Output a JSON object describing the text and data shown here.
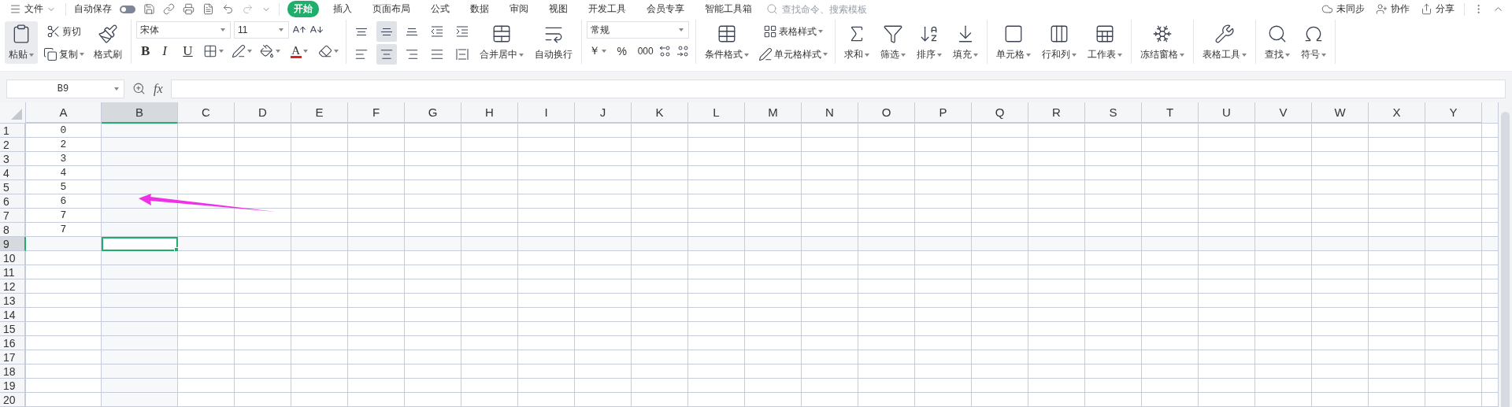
{
  "menu": {
    "file": "文件",
    "autosave": {
      "label": "自动保存",
      "on": false
    }
  },
  "tabs": [
    {
      "label": "开始",
      "selected": true
    },
    {
      "label": "插入",
      "selected": false
    },
    {
      "label": "页面布局",
      "selected": false
    },
    {
      "label": "公式",
      "selected": false
    },
    {
      "label": "数据",
      "selected": false
    },
    {
      "label": "审阅",
      "selected": false
    },
    {
      "label": "视图",
      "selected": false
    },
    {
      "label": "开发工具",
      "selected": false
    },
    {
      "label": "会员专享",
      "selected": false
    },
    {
      "label": "智能工具箱",
      "selected": false
    }
  ],
  "search": {
    "placeholder": "查找命令、搜索模板"
  },
  "account": {
    "sync": "未同步",
    "collaborate": "协作",
    "share": "分享"
  },
  "clipboard": {
    "paste": "粘贴",
    "cut": "剪切",
    "copy": "复制",
    "format_painter": "格式刷"
  },
  "font": {
    "name": "宋体",
    "size": "11",
    "bold": "B",
    "italic": "I",
    "underline": "U",
    "font_color": "A"
  },
  "alignment": {
    "buttons": [
      {
        "kind": "top",
        "selected": false
      },
      {
        "kind": "middle",
        "selected": true
      },
      {
        "kind": "bottom",
        "selected": false
      },
      {
        "kind": "indent-decrease",
        "selected": false
      },
      {
        "kind": "indent-increase",
        "selected": false
      },
      {
        "kind": "left",
        "selected": false
      },
      {
        "kind": "center",
        "selected": true
      },
      {
        "kind": "right",
        "selected": false
      },
      {
        "kind": "justify",
        "selected": false
      },
      {
        "kind": "distributed",
        "selected": false
      }
    ],
    "merge": "合并居中",
    "wrap": "自动换行"
  },
  "number": {
    "format": "常规",
    "currency": "￥",
    "percent": "%",
    "thousands": "000"
  },
  "styles": {
    "conditional": "条件格式",
    "table_style": "表格样式",
    "cell_style": "单元格样式"
  },
  "tool_groups": [
    {
      "tools": [
        {
          "kind": "sum",
          "label": "求和"
        },
        {
          "kind": "filter",
          "label": "筛选"
        },
        {
          "kind": "sort",
          "label": "排序"
        },
        {
          "kind": "fill",
          "label": "填充"
        }
      ]
    },
    {
      "tools": [
        {
          "kind": "cell",
          "label": "单元格"
        },
        {
          "kind": "rowcol",
          "label": "行和列"
        },
        {
          "kind": "sheet",
          "label": "工作表"
        }
      ]
    },
    {
      "tools": [
        {
          "kind": "freeze",
          "label": "冻结窗格"
        }
      ]
    },
    {
      "tools": [
        {
          "kind": "tabletools",
          "label": "表格工具"
        }
      ]
    },
    {
      "tools": [
        {
          "kind": "find",
          "label": "查找"
        },
        {
          "kind": "symbol",
          "label": "符号"
        }
      ]
    }
  ],
  "formula_bar": {
    "name_box": "B9",
    "fx": "fx"
  },
  "sheet": {
    "columns": [
      {
        "label": "A",
        "selected": false
      },
      {
        "label": "B",
        "selected": true
      },
      {
        "label": "C",
        "selected": false
      },
      {
        "label": "D",
        "selected": false
      },
      {
        "label": "E",
        "selected": false
      },
      {
        "label": "F",
        "selected": false
      },
      {
        "label": "G",
        "selected": false
      },
      {
        "label": "H",
        "selected": false
      },
      {
        "label": "I",
        "selected": false
      },
      {
        "label": "J",
        "selected": false
      },
      {
        "label": "K",
        "selected": false
      },
      {
        "label": "L",
        "selected": false
      },
      {
        "label": "M",
        "selected": false
      },
      {
        "label": "N",
        "selected": false
      },
      {
        "label": "O",
        "selected": false
      },
      {
        "label": "P",
        "selected": false
      },
      {
        "label": "Q",
        "selected": false
      },
      {
        "label": "R",
        "selected": false
      },
      {
        "label": "S",
        "selected": false
      },
      {
        "label": "T",
        "selected": false
      },
      {
        "label": "U",
        "selected": false
      },
      {
        "label": "V",
        "selected": false
      },
      {
        "label": "W",
        "selected": false
      },
      {
        "label": "X",
        "selected": false
      },
      {
        "label": "Y",
        "selected": false
      }
    ],
    "rows": [
      {
        "label": "1",
        "selected": false,
        "cells": [
          "0"
        ]
      },
      {
        "label": "2",
        "selected": false,
        "cells": [
          "2"
        ]
      },
      {
        "label": "3",
        "selected": false,
        "cells": [
          "3"
        ]
      },
      {
        "label": "4",
        "selected": false,
        "cells": [
          "4"
        ]
      },
      {
        "label": "5",
        "selected": false,
        "cells": [
          "5"
        ]
      },
      {
        "label": "6",
        "selected": false,
        "cells": [
          "6"
        ]
      },
      {
        "label": "7",
        "selected": false,
        "cells": [
          "7"
        ]
      },
      {
        "label": "8",
        "selected": false,
        "cells": [
          "7"
        ]
      },
      {
        "label": "9",
        "selected": true
      },
      {
        "label": "10",
        "selected": false
      },
      {
        "label": "11",
        "selected": false
      },
      {
        "label": "12",
        "selected": false
      },
      {
        "label": "13",
        "selected": false
      },
      {
        "label": "14",
        "selected": false
      },
      {
        "label": "15",
        "selected": false
      },
      {
        "label": "16",
        "selected": false
      },
      {
        "label": "17",
        "selected": false
      },
      {
        "label": "18",
        "selected": false
      },
      {
        "label": "19",
        "selected": false
      },
      {
        "label": "20",
        "selected": false
      }
    ]
  }
}
